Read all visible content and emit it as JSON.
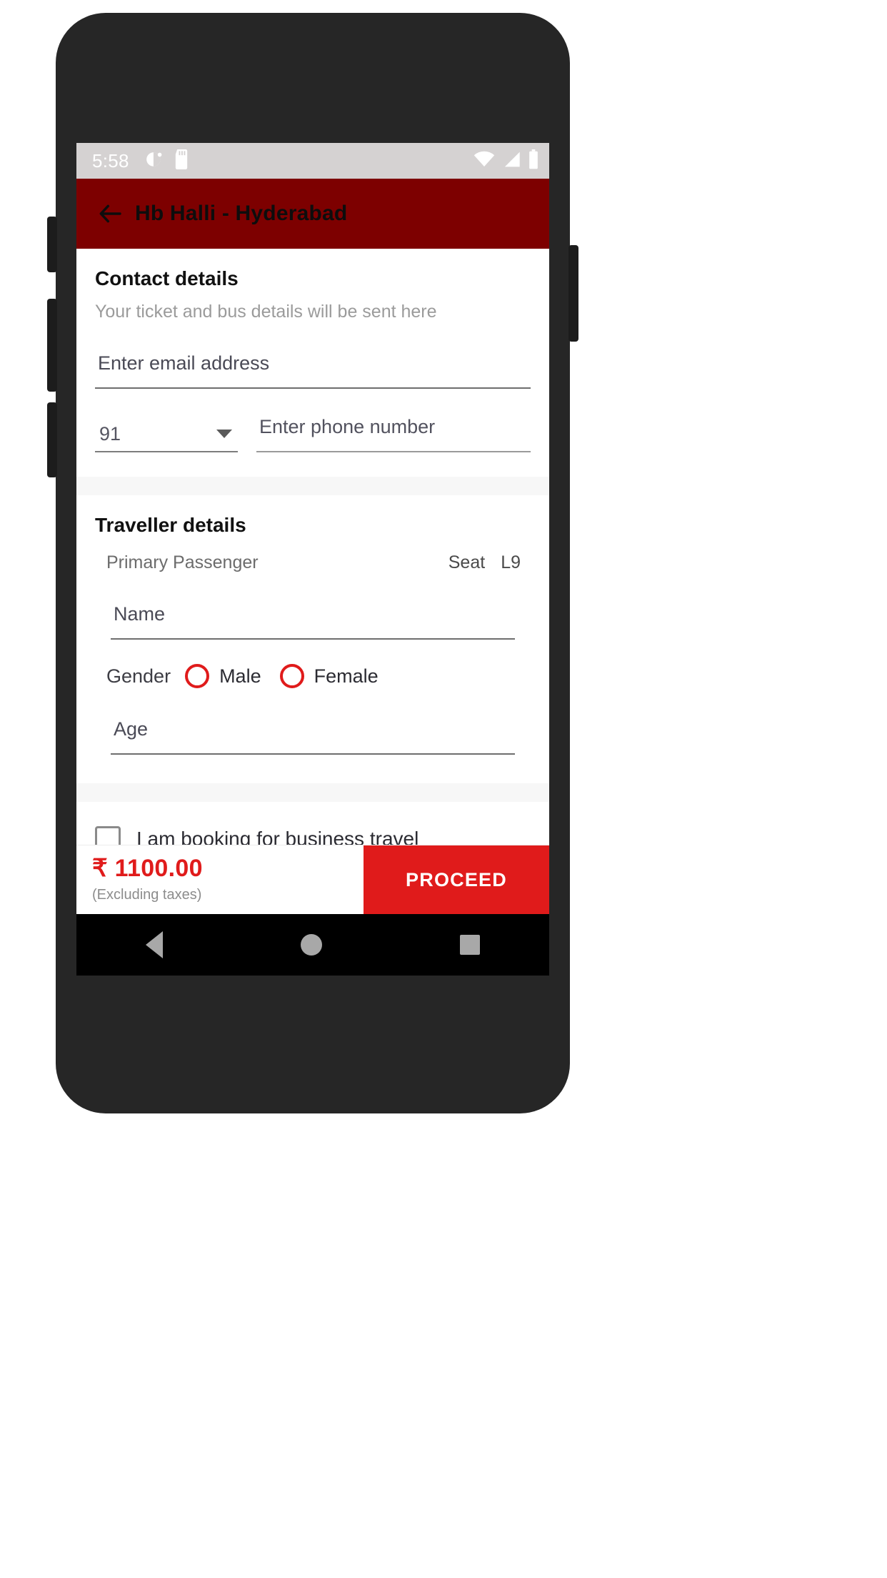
{
  "status_bar": {
    "time": "5:58",
    "left_icons": [
      "do-not-disturb-icon",
      "sd-card-icon"
    ],
    "right_icons": [
      "wifi-icon",
      "cellular-signal-icon",
      "battery-icon"
    ]
  },
  "app_bar": {
    "back_icon": "back-arrow-icon",
    "title": "Hb Halli - Hyderabad",
    "background": "#7d0000"
  },
  "contact": {
    "title": "Contact details",
    "subtitle": "Your ticket and bus details will be sent here",
    "email_placeholder": "Enter email address",
    "email_value": "",
    "country_code": "91",
    "country_code_caret": "chevron-down-icon",
    "phone_placeholder": "Enter phone number",
    "phone_value": ""
  },
  "traveller": {
    "title": "Traveller details",
    "passenger_label": "Primary Passenger",
    "seat_label": "Seat",
    "seat_number": "L9",
    "name_placeholder": "Name",
    "name_value": "",
    "gender_label": "Gender",
    "gender_options": [
      {
        "label": "Male",
        "selected": false
      },
      {
        "label": "Female",
        "selected": false
      }
    ],
    "age_placeholder": "Age",
    "age_value": ""
  },
  "business": {
    "label": "I am booking for business travel",
    "checked": false
  },
  "bottom_bar": {
    "currency_symbol": "₹",
    "amount": "₹ 1100.00",
    "note": "(Excluding taxes)",
    "proceed_label": "PROCEED",
    "accent_color": "#e01b1b"
  },
  "nav_bar": {
    "back": "nav-back-icon",
    "home": "nav-home-icon",
    "recents": "nav-recents-icon"
  }
}
